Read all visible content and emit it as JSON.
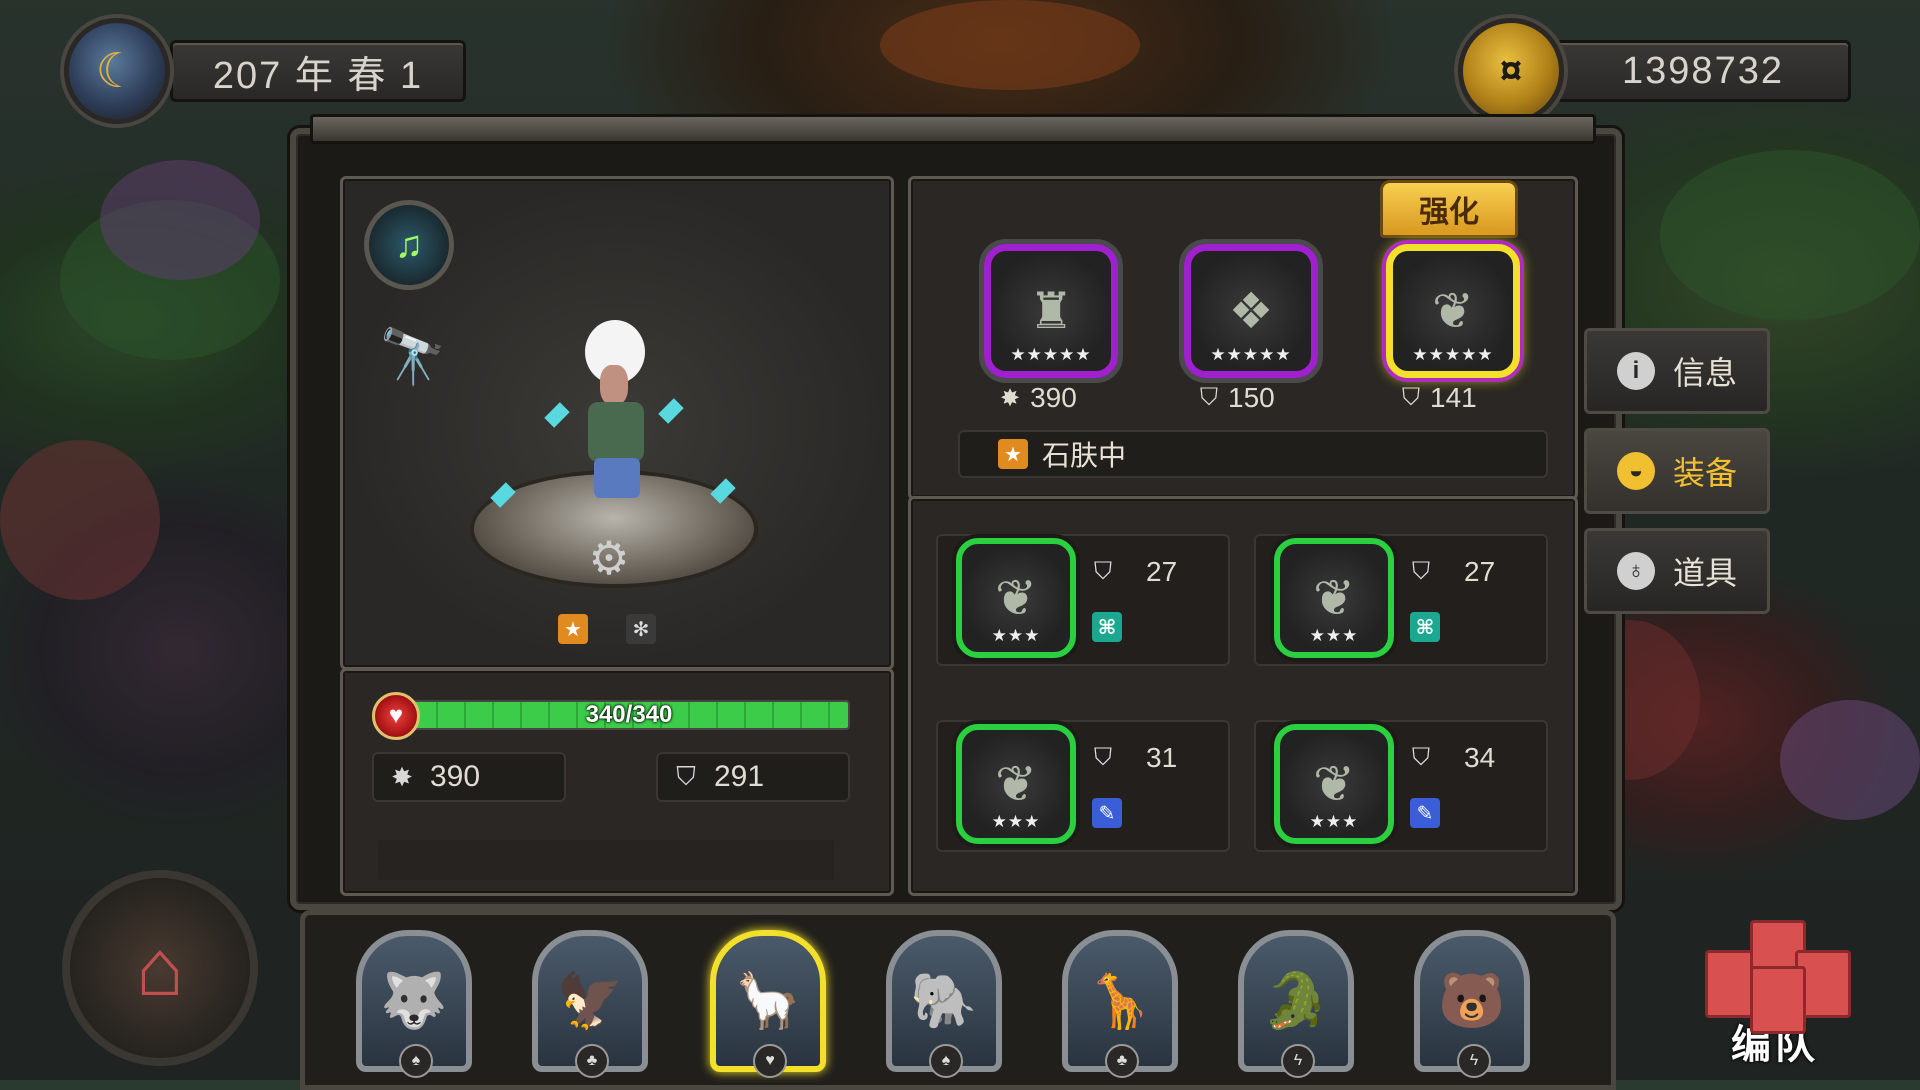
{
  "header": {
    "date": "207 年 春 1",
    "gold": "1398732"
  },
  "hero": {
    "hp": "340/340",
    "hp_fraction": 1.0,
    "attack": "390",
    "defense": "291"
  },
  "equipment": {
    "enhance_label": "强化",
    "slots": [
      {
        "stat_value": "390",
        "stat_icon": "attack-icon",
        "rarity": "purple",
        "stars": "★★★★★"
      },
      {
        "stat_value": "150",
        "stat_icon": "shield-icon",
        "rarity": "purple",
        "stars": "★★★★★"
      },
      {
        "stat_value": "141",
        "stat_icon": "shield-icon",
        "rarity": "purple",
        "stars": "★★★★★",
        "selected": true
      }
    ],
    "state_text": "石肤中"
  },
  "inventory": [
    {
      "value": "27",
      "stars": "★★★",
      "badge": "teal"
    },
    {
      "value": "27",
      "stars": "★★★",
      "badge": "teal"
    },
    {
      "value": "31",
      "stars": "★★★",
      "badge": "blue"
    },
    {
      "value": "34",
      "stars": "★★★",
      "badge": "blue"
    }
  ],
  "side_tabs": [
    {
      "label": "信息",
      "icon": "info-icon"
    },
    {
      "label": "装备",
      "icon": "helmet-icon",
      "active": true
    },
    {
      "label": "道具",
      "icon": "potion-icon"
    }
  ],
  "team_button": "编队",
  "colors": {
    "rarity_purple": "#a020d0",
    "rarity_green": "#2ad040",
    "selected": "#f2e02a",
    "hp": "#3dcc4a",
    "active_tab": "#f0c030"
  }
}
